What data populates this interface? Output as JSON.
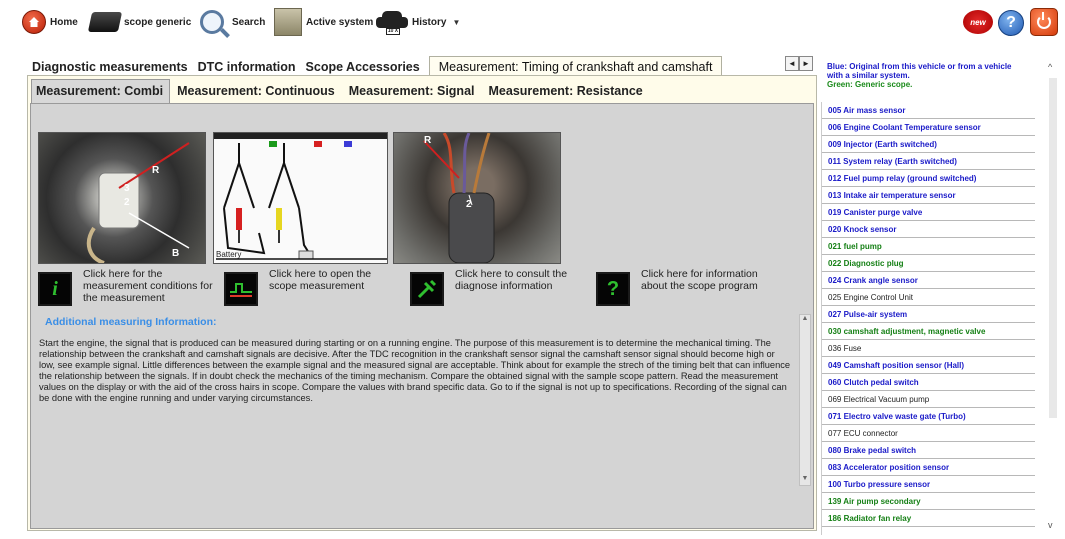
{
  "toolbar": {
    "home_label": "Home",
    "scope_label": "scope generic",
    "search_label": "Search",
    "active_label": "Active system",
    "history_label": "History",
    "history_plate": "10 X",
    "new_badge": "new",
    "help_symbol": "?",
    "icons": {
      "home": "home-icon",
      "scope": "scope-icon",
      "search": "search-icon",
      "active": "active-system-icon",
      "history": "car-icon",
      "new": "new-icon",
      "help": "help-icon",
      "power": "power-icon"
    }
  },
  "tabs1": [
    {
      "label": "Diagnostic measurements",
      "active": false
    },
    {
      "label": "DTC information",
      "active": false
    },
    {
      "label": "Scope Accessories",
      "active": false
    },
    {
      "label": "Measurement: Timing of crankshaft and camshaft",
      "active": true
    }
  ],
  "nav": {
    "left": "◄",
    "right": "►"
  },
  "tabs2": [
    {
      "label": "Measurement: Combi",
      "active": true
    },
    {
      "label": "Measurement: Continuous",
      "active": false
    },
    {
      "label": "Measurement: Signal",
      "active": false
    },
    {
      "label": "Measurement: Resistance",
      "active": false
    }
  ],
  "photos": {
    "photo1": {
      "labels": [
        "R",
        "3",
        "2",
        "B"
      ]
    },
    "photo2": {
      "label": "Battery"
    },
    "photo3": {
      "labels": [
        "R",
        "2"
      ]
    }
  },
  "actions": [
    {
      "text": "Click here for the measurement conditions for the measurement",
      "icon": "info-icon",
      "glyph": "i",
      "color": "#2fbf2f"
    },
    {
      "text": "Click here to open the scope measurement",
      "icon": "scope-measurement-icon",
      "glyph": "",
      "color": "#e03a2a"
    },
    {
      "text": "Click here to consult the diagnose information",
      "icon": "diagnose-icon",
      "glyph": "",
      "color": "#2fbf2f"
    },
    {
      "text": "Click here for information about the scope program",
      "icon": "question-icon",
      "glyph": "?",
      "color": "#2fbf2f"
    }
  ],
  "info": {
    "title": "Additional measuring Information:",
    "body": "Start the engine, the signal that is produced can be measured during starting or on a running engine. The purpose of this measurement is to determine the mechanical timing. The relationship between the crankshaft and camshaft signals are decisive. After the TDC recognition in the crankshaft sensor signal the camshaft sensor signal should become high or low, see example signal. Little differences between the example signal and the measured signal are acceptable. Think about for example the strech of the timing belt that can influence the relationship between the signals. If in doubt check the mechanics of the timing mechanism. Compare the obtained signal with the sample scope pattern. Read the measurement values on the display or with the aid of the cross hairs in scope. Compare the values with brand specific data. Go to  if the signal is not up to specifications. Recording of the signal can be done with the engine running and under varying circumstances."
  },
  "legend": {
    "blue": "Blue: Original from this vehicle or from a vehicle with a similar system.",
    "green": "Green: Generic scope."
  },
  "sensors": [
    {
      "label": "005 Air mass sensor",
      "color": "blue"
    },
    {
      "label": "006 Engine Coolant Temperature sensor",
      "color": "blue"
    },
    {
      "label": "009 Injector (Earth switched)",
      "color": "blue"
    },
    {
      "label": "011 System relay (Earth switched)",
      "color": "blue"
    },
    {
      "label": "012 Fuel pump relay (ground switched)",
      "color": "blue"
    },
    {
      "label": "013 Intake air temperature sensor",
      "color": "blue"
    },
    {
      "label": "019 Canister purge valve",
      "color": "blue"
    },
    {
      "label": "020 Knock sensor",
      "color": "blue"
    },
    {
      "label": "021 fuel pump",
      "color": "green"
    },
    {
      "label": "022 Diagnostic plug",
      "color": "green"
    },
    {
      "label": "024 Crank angle sensor",
      "color": "blue"
    },
    {
      "label": "025 Engine Control Unit",
      "color": "black"
    },
    {
      "label": "027 Pulse-air system",
      "color": "blue"
    },
    {
      "label": "030 camshaft adjustment, magnetic valve",
      "color": "green"
    },
    {
      "label": "036 Fuse",
      "color": "black"
    },
    {
      "label": "049 Camshaft position sensor (Hall)",
      "color": "blue"
    },
    {
      "label": "060 Clutch pedal switch",
      "color": "blue"
    },
    {
      "label": "069 Electrical Vacuum pump",
      "color": "black"
    },
    {
      "label": "071 Electro valve waste gate (Turbo)",
      "color": "blue"
    },
    {
      "label": "077 ECU connector",
      "color": "black"
    },
    {
      "label": "080 Brake pedal switch",
      "color": "blue"
    },
    {
      "label": "083 Accelerator position sensor",
      "color": "blue"
    },
    {
      "label": "100 Turbo pressure sensor",
      "color": "blue"
    },
    {
      "label": "139 Air pump secondary",
      "color": "green"
    },
    {
      "label": "186 Radiator fan relay",
      "color": "green"
    }
  ]
}
